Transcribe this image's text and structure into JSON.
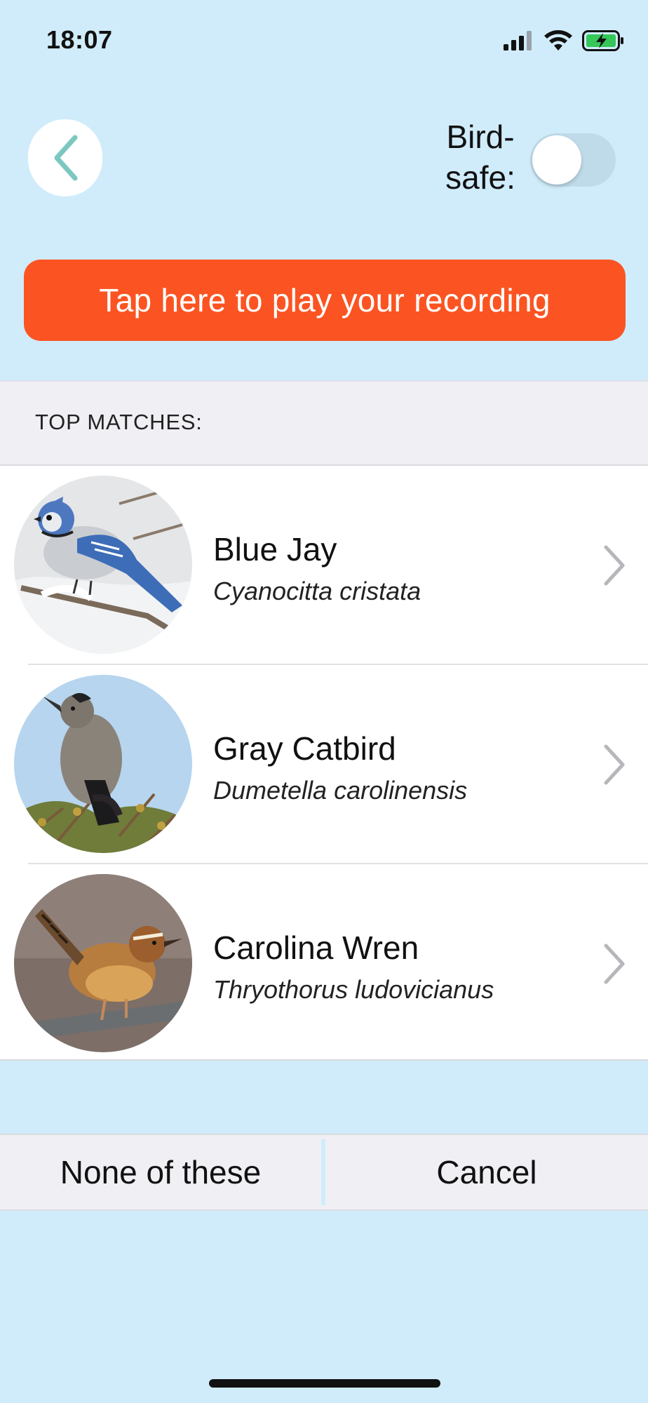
{
  "status_bar": {
    "time": "18:07",
    "icons": [
      "cellular-signal-icon",
      "wifi-icon",
      "battery-charging-icon"
    ]
  },
  "header": {
    "back_icon": "chevron-left-icon",
    "birdsafe_label_line1": "Bird-",
    "birdsafe_label_line2": "safe:",
    "birdsafe_enabled": false
  },
  "play_button": {
    "label": "Tap here to play your recording",
    "color": "#fb5422"
  },
  "matches": {
    "header": "TOP MATCHES:",
    "items": [
      {
        "name": "Blue Jay",
        "scientific": "Cyanocitta cristata",
        "photo": "blue-jay-photo"
      },
      {
        "name": "Gray Catbird",
        "scientific": "Dumetella carolinensis",
        "photo": "gray-catbird-photo"
      },
      {
        "name": "Carolina Wren",
        "scientific": "Thryothorus ludovicianus",
        "photo": "carolina-wren-photo"
      }
    ]
  },
  "footer": {
    "none_label": "None of these",
    "cancel_label": "Cancel"
  },
  "colors": {
    "background": "#d0ecfb",
    "accent": "#fb5422",
    "back_chevron": "#7cc8c0"
  }
}
